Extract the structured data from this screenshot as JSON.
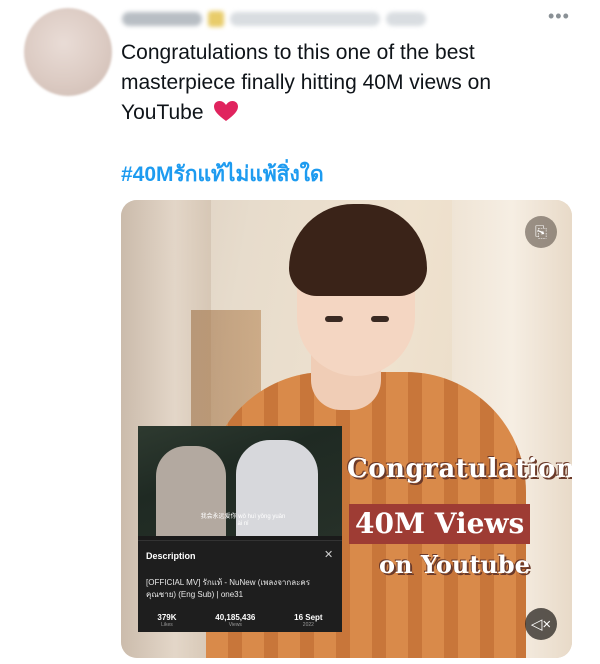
{
  "tweet": {
    "text": "Congratulations to this one of the best masterpiece finally hitting 40M views on YouTube",
    "hashtag": "#40Mรักแท้ไม่แพ้สิ่งใด",
    "more_icon": "more-horizontal-icon",
    "heart_color": "#e0245e",
    "hashtag_color": "#1d9bf0"
  },
  "media": {
    "overlay_line1": "Congratulation",
    "overlay_line2": "40M Views",
    "overlay_line3": "on Youtube",
    "cc_icon": "captions-icon",
    "mute_icon": "volume-mute-icon",
    "inset": {
      "subtitle": "我会永远爱你 wǒ huì yǒng yuǎn ài nǐ",
      "description_title": "Description",
      "description_text": "[OFFICIAL MV] รักแท้ - NuNew (เพลงจากละคร คุณชาย) (Eng Sub) | one31",
      "stats": [
        {
          "value": "379K",
          "label": "Likes"
        },
        {
          "value": "40,185,436",
          "label": "Views"
        },
        {
          "value": "16 Sept",
          "label": "2022"
        }
      ]
    }
  }
}
